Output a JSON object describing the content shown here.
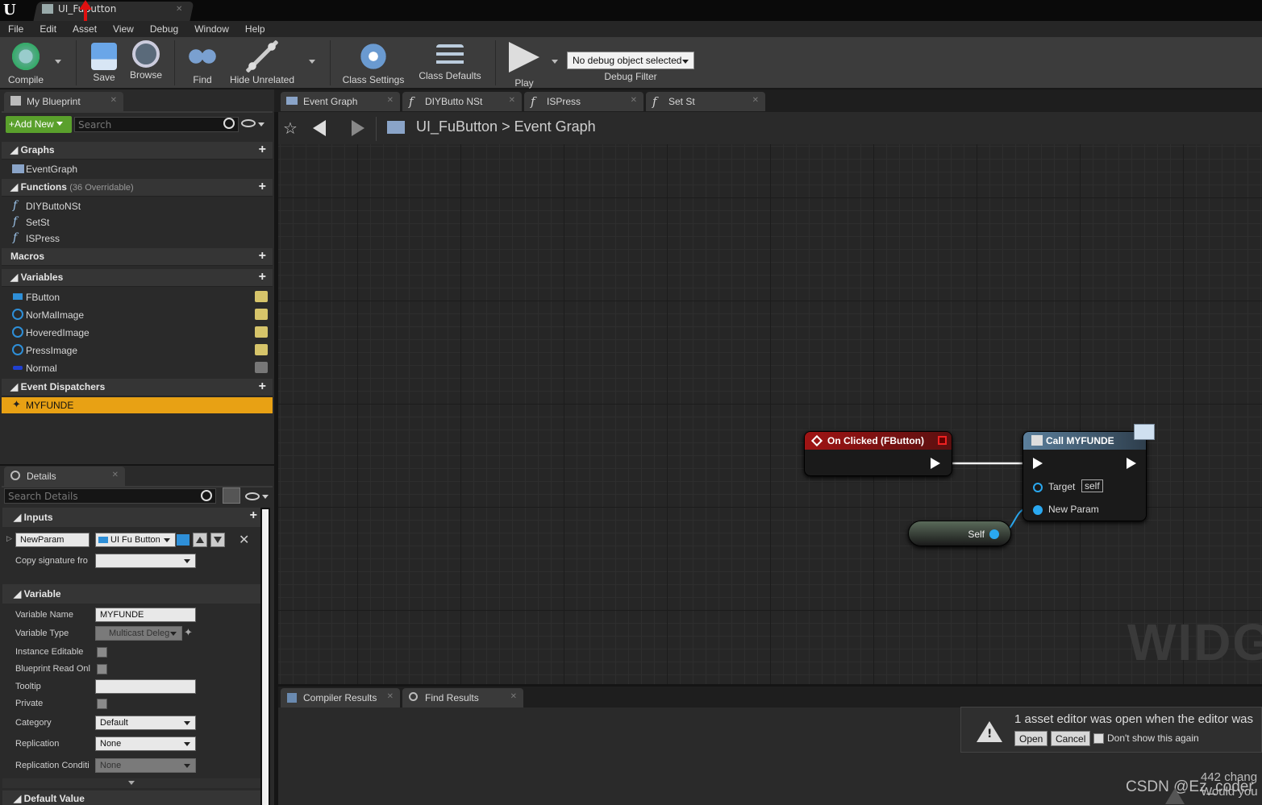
{
  "window": {
    "logo": "U",
    "doc_tab": "UI_FuButton"
  },
  "menu": [
    "File",
    "Edit",
    "Asset",
    "View",
    "Debug",
    "Window",
    "Help"
  ],
  "toolbar": {
    "compile": "Compile",
    "save": "Save",
    "browse": "Browse",
    "find": "Find",
    "hide_unrelated": "Hide Unrelated",
    "class_settings": "Class Settings",
    "class_defaults": "Class Defaults",
    "play": "Play",
    "debug_select": "No debug object selected",
    "debug_filter": "Debug Filter"
  },
  "my_blueprint": {
    "tab": "My Blueprint",
    "add_new": "Add New",
    "search_placeholder": "Search",
    "graphs": {
      "title": "Graphs",
      "items": [
        "EventGraph"
      ]
    },
    "functions": {
      "title": "Functions",
      "overridable": "(36 Overridable)",
      "items": [
        "DIYButtoNSt",
        "SetSt",
        "ISPress"
      ]
    },
    "macros": {
      "title": "Macros"
    },
    "variables": {
      "title": "Variables",
      "items": [
        "FButton",
        "NorMalImage",
        "HoveredImage",
        "PressImage",
        "Normal"
      ]
    },
    "dispatchers": {
      "title": "Event Dispatchers",
      "items": [
        "MYFUNDE"
      ]
    }
  },
  "details": {
    "tab": "Details",
    "search_placeholder": "Search Details",
    "inputs": {
      "title": "Inputs",
      "param_name": "NewParam",
      "param_type": "UI Fu Button",
      "copy_signature": "Copy signature fro"
    },
    "variable": {
      "title": "Variable",
      "name_label": "Variable Name",
      "name_value": "MYFUNDE",
      "type_label": "Variable Type",
      "type_value": "Multicast Deleg",
      "instance_editable": "Instance Editable",
      "bp_readonly": "Blueprint Read Onl",
      "tooltip": "Tooltip",
      "private": "Private",
      "category": "Category",
      "category_value": "Default",
      "replication": "Replication",
      "replication_value": "None",
      "replication_cond": "Replication Conditi",
      "replication_cond_value": "None"
    },
    "default_value": "Default Value"
  },
  "graph_tabs": [
    "Event Graph",
    "DIYButto NSt",
    "ISPress",
    "Set St"
  ],
  "breadcrumb": {
    "root": "UI_FuButton",
    "sep": ">",
    "leaf": "Event Graph"
  },
  "nodes": {
    "on_clicked": "On Clicked (FButton)",
    "call": "Call MYFUNDE",
    "target": "Target",
    "target_value": "self",
    "new_param": "New Param",
    "self": "Self"
  },
  "watermark": "WIDGE",
  "bottom_tabs": [
    "Compiler Results",
    "Find Results"
  ],
  "notification": {
    "text": "1 asset editor was open when the editor was",
    "open": "Open",
    "cancel": "Cancel",
    "dont_show": "Don't show this again"
  },
  "overlay": {
    "csdn": "CSDN @Ez_coder",
    "line1": "442 chang",
    "line2": "Would you"
  },
  "colors": {
    "accent": "#e8a114",
    "add_new": "#5aa02c",
    "event_node": "#8b1212",
    "call_node": "#4a6f8a"
  }
}
